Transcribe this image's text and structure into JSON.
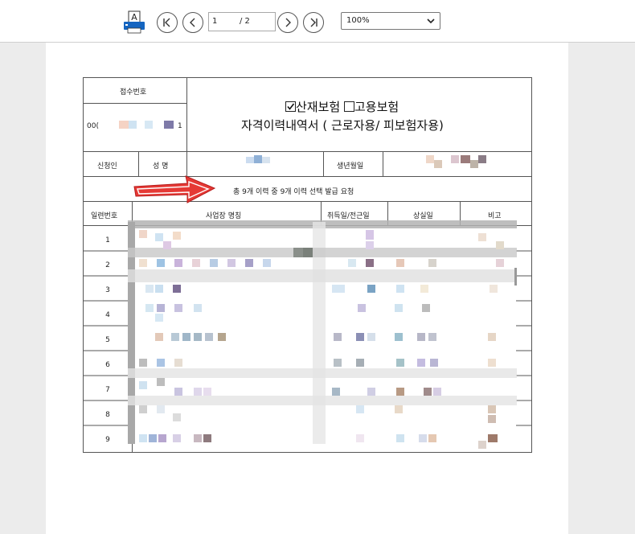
{
  "toolbar": {
    "page_current": "1",
    "page_total": "/ 2",
    "zoom": "100%",
    "print_icon": "print-icon",
    "nav_icons": [
      "first-page-icon",
      "prev-page-icon",
      "next-page-icon",
      "last-page-icon"
    ]
  },
  "form": {
    "receipt_label": "접수번호",
    "receipt_value_prefix": "00(",
    "receipt_value_suffix": "1",
    "title_line1_opt1": "산재보험",
    "title_line1_opt2": "고용보험",
    "opt1_checked": true,
    "opt2_checked": false,
    "title_line2": "자격이력내역서 ( 근로자용/ 피보험자용)",
    "applicant_label": "신청인",
    "name_label": "성 명",
    "birth_label": "생년월일",
    "summary": "총 9개 이력 중 9개 이력 선택 발급 요청",
    "columns": [
      "일련번호",
      "사업장 명칭",
      "취득일/전근일",
      "상실일",
      "비고"
    ],
    "rows": [
      "1",
      "2",
      "3",
      "4",
      "5",
      "6",
      "7",
      "8",
      "9"
    ]
  },
  "colors": {
    "arrow": "#e53935",
    "border": "#555555",
    "redaction_gray": "#b3b3b3"
  }
}
